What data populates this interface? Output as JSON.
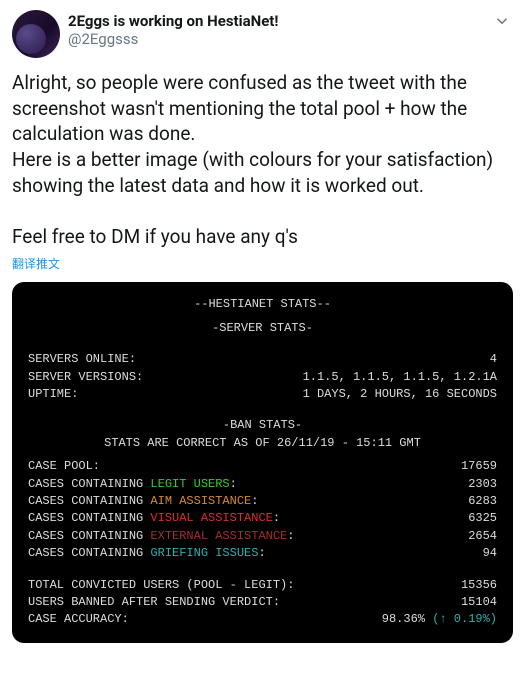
{
  "tweet": {
    "display_name": "2Eggs is working on HestiaNet!",
    "handle": "@2Eggsss",
    "body": "Alright, so people were confused as the tweet with the screenshot wasn't mentioning the total pool + how the calculation was done.\nHere is a better image (with colours for your satisfaction) showing the latest data and how it is worked out.\n\nFeel free to DM if you have any q's",
    "translate": "翻译推文"
  },
  "terminal": {
    "title": "--HESTIANET STATS--",
    "section_server": "-SERVER STATS-",
    "servers_online_label": "SERVERS ONLINE:",
    "servers_online_val": "4",
    "server_versions_label": "SERVER VERSIONS:",
    "server_versions_val": "1.1.5, 1.1.5, 1.1.5, 1.2.1A",
    "uptime_label": "UPTIME:",
    "uptime_val": "1 DAYS, 2 HOURS, 16 SECONDS",
    "section_ban": "-BAN STATS-",
    "asof": "STATS ARE CORRECT AS OF 26/11/19 - 15:11 GMT",
    "case_pool_label": "CASE POOL:",
    "case_pool_val": "17659",
    "legit_prefix": "CASES CONTAINING ",
    "legit_colored": "LEGIT USERS",
    "legit_suffix": ":",
    "legit_val": "2303",
    "aim_prefix": "CASES CONTAINING ",
    "aim_colored": "AIM ASSISTANCE",
    "aim_suffix": ":",
    "aim_val": "6283",
    "visual_prefix": "CASES CONTAINING ",
    "visual_colored": "VISUAL ASSISTANCE",
    "visual_suffix": ":",
    "visual_val": "6325",
    "external_prefix": "CASES CONTAINING ",
    "external_colored": "EXTERNAL ASSISTANCE",
    "external_suffix": ":",
    "external_val": "2654",
    "grief_prefix": "CASES CONTAINING ",
    "grief_colored": "GRIEFING ISSUES",
    "grief_suffix": ":",
    "grief_val": "94",
    "convicted_label": "TOTAL CONVICTED USERS (POOL - LEGIT):",
    "convicted_val": "15356",
    "banned_label": "USERS BANNED AFTER SENDING VERDICT:",
    "banned_val": "15104",
    "accuracy_label": "CASE ACCURACY:",
    "accuracy_val": "98.36% ",
    "accuracy_delta": "(↑ 0.19%)"
  }
}
